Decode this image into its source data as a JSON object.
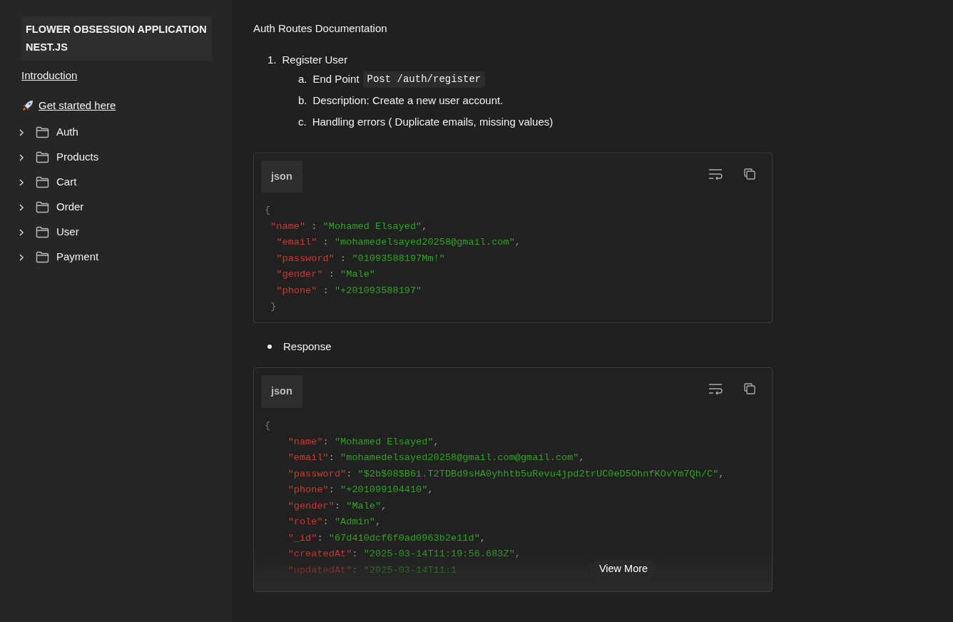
{
  "sidebar": {
    "title": "FLOWER OBSESSION APPLICATION NEST.JS",
    "links": [
      {
        "label": "Introduction"
      },
      {
        "label": "Get started here"
      }
    ],
    "folders": [
      {
        "label": "Auth",
        "expanded": false
      },
      {
        "label": "Products",
        "expanded": false
      },
      {
        "label": "Cart",
        "expanded": false
      },
      {
        "label": "Order",
        "expanded": false
      },
      {
        "label": "User",
        "expanded": false
      },
      {
        "label": "Payment",
        "expanded": false
      }
    ]
  },
  "content": {
    "heading": "Auth Routes Documentation",
    "steps": [
      {
        "number": "1.",
        "label": "Register User",
        "items": [
          {
            "marker": "a.",
            "text": "End Point",
            "code": "Post /auth/register"
          },
          {
            "marker": "b.",
            "text": "Description: Create a new user account."
          },
          {
            "marker": "c.",
            "text": "Handling errors ( Duplicate emails, missing values)"
          }
        ]
      }
    ],
    "request_block": {
      "language": "json",
      "collapsed": false,
      "lines": [
        {
          "kind": "brace",
          "text": "{"
        },
        {
          "kind": "pair",
          "key": "\"name\"",
          "sep": " : ",
          "value": "\"Mohamed Elsayed\"",
          "trail": ","
        },
        {
          "kind": "pair",
          "key": "\"email\"",
          "sep": " : ",
          "value": "\"mohamedelsayed20258@gmail.com\"",
          "trail": ","
        },
        {
          "kind": "pair",
          "key": "\"password\"",
          "sep": " : ",
          "value": "\"01093588197Mm!\""
        },
        {
          "kind": "pair",
          "key": "\"gender\"",
          "sep": " : ",
          "value": "\"Male\""
        },
        {
          "kind": "pair",
          "key": "\"phone\"",
          "sep": " : ",
          "value": "\"+201093588197\""
        },
        {
          "kind": "brace",
          "text": "}"
        }
      ]
    },
    "bullet": "Response",
    "response_block": {
      "language": "json",
      "collapsed": true,
      "more_label": "View More",
      "lines": [
        {
          "kind": "brace",
          "text": "{"
        },
        {
          "kind": "pair",
          "key": "\"name\"",
          "sep": ": ",
          "value": "\"Mohamed Elsayed\"",
          "trail": ","
        },
        {
          "kind": "pair",
          "key": "\"email\"",
          "sep": ": ",
          "value": "\"mohamedelsayed20258@gmail.com@gmail.com\"",
          "trail": ","
        },
        {
          "kind": "pair",
          "key": "\"password\"",
          "sep": ": ",
          "value": "\"$2b$08$B6i.T2TDBd9sHA0yhhtb5uRevu4jpd2trUC0eD5OhnfKOvYm7Qh/C\"",
          "trail": ","
        },
        {
          "kind": "pair",
          "key": "\"phone\"",
          "sep": ": ",
          "value": "\"+201099104410\"",
          "trail": ","
        },
        {
          "kind": "pair",
          "key": "\"gender\"",
          "sep": ": ",
          "value": "\"Male\"",
          "trail": ","
        },
        {
          "kind": "pair",
          "key": "\"role\"",
          "sep": ": ",
          "value": "\"Admin\"",
          "trail": ","
        },
        {
          "kind": "pair",
          "key": "\"_id\"",
          "sep": ": ",
          "value": "\"67d410dcf6f0ad0963b2e11d\"",
          "trail": ","
        },
        {
          "kind": "pair",
          "key": "\"createdAt\"",
          "sep": ": ",
          "value": "\"2025-03-14T11:19:56.683Z\"",
          "trail": ","
        },
        {
          "kind": "pair",
          "key": "\"updatedAt\"",
          "sep": ": ",
          "value": "\"2025-03-14T11:1"
        }
      ]
    }
  }
}
